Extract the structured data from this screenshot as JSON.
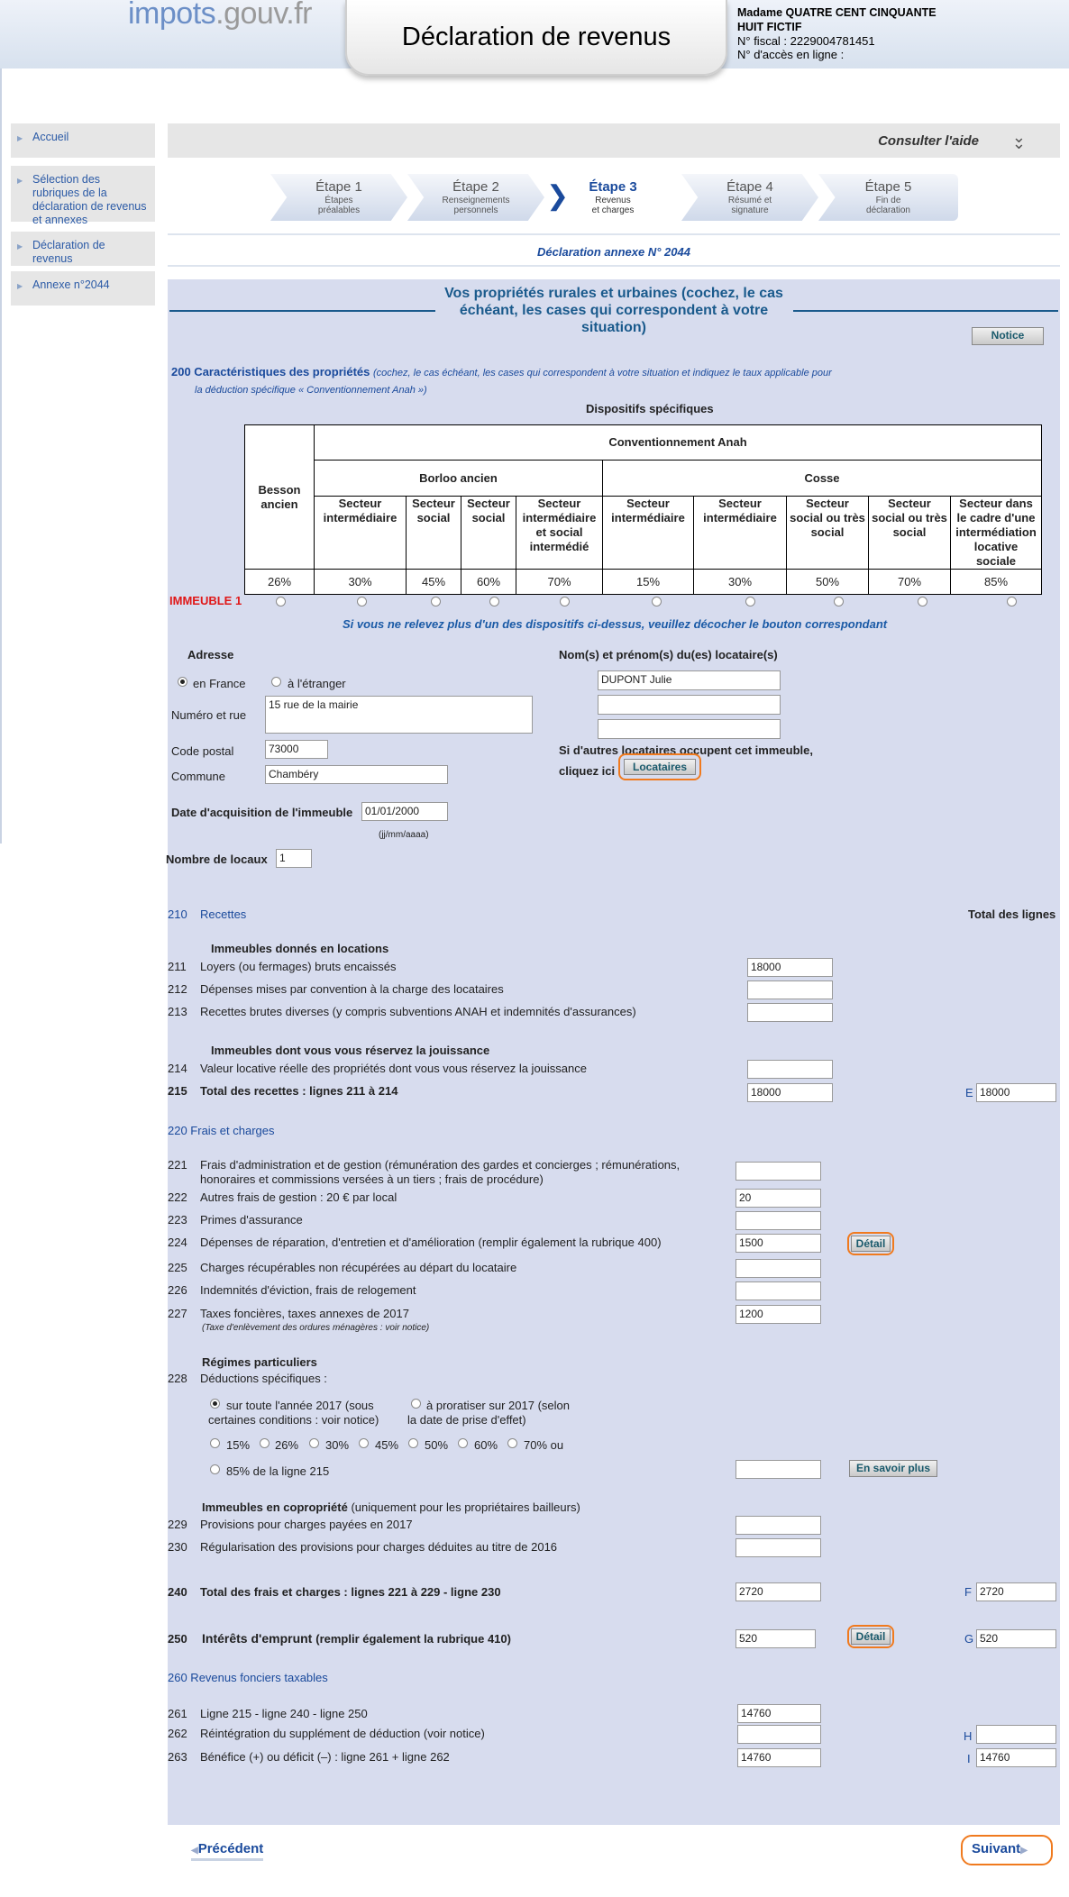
{
  "header": {
    "logo_main": "impots",
    "logo_domain": ".gouv.fr",
    "title": "Déclaration de revenus",
    "user_name": "Madame QUATRE CENT CINQUANTE HUIT FICTIF",
    "fiscal_number": "N° fiscal : 2229004781451",
    "access_number": "N° d'accès en ligne :"
  },
  "sidebar": {
    "items": [
      {
        "label": "Accueil"
      },
      {
        "label": "Sélection des rubriques de la déclaration de revenus et annexes"
      },
      {
        "label": "Déclaration de revenus"
      },
      {
        "label": "Annexe n°2044"
      }
    ]
  },
  "help": {
    "label": "Consulter l'aide",
    "icon": "double-chevron-down-icon"
  },
  "steps": [
    {
      "title": "Étape 1",
      "sub1": "Étapes",
      "sub2": "préalables"
    },
    {
      "title": "Étape 2",
      "sub1": "Renseignements",
      "sub2": "personnels"
    },
    {
      "title": "Étape 3",
      "sub1": "Revenus",
      "sub2": "et charges"
    },
    {
      "title": "Étape 4",
      "sub1": "Résumé et",
      "sub2": "signature"
    },
    {
      "title": "Étape 5",
      "sub1": "Fin de",
      "sub2": "déclaration"
    }
  ],
  "annexe_title": "Déclaration annexe N° 2044",
  "section": {
    "title_l1": "Vos propriétés rurales et urbaines (cochez, le cas",
    "title_l2": "échéant, les cases qui correspondent à votre",
    "title_l3": "situation)",
    "notice_button": "Notice"
  },
  "caract": {
    "number_title": "200 Caractéristiques des propriétés",
    "hint_l1": "(cochez, le cas échéant, les cases qui correspondent à votre situation et indiquez le taux applicable pour",
    "hint_l2": "la déduction spécifique « Conventionnement Anah »)",
    "dispositifs": "Dispositifs spécifiques"
  },
  "grid": {
    "anah": "Conventionnement Anah",
    "besson": "Besson ancien",
    "borloo": "Borloo ancien",
    "cosse": "Cosse",
    "cols": [
      "Secteur intermédiaire",
      "Secteur social",
      "Secteur social",
      "Secteur intermédiaire et social intermédié",
      "Secteur intermédiaire",
      "Secteur intermédiaire",
      "Secteur social ou très social",
      "Secteur social ou très social",
      "Secteur dans le cadre d'une intermédiation locative sociale"
    ],
    "pcts": [
      "26%",
      "30%",
      "45%",
      "60%",
      "70%",
      "15%",
      "30%",
      "50%",
      "70%",
      "85%"
    ]
  },
  "immeuble_label": "IMMEUBLE 1",
  "dispositif_note": "Si vous ne relevez plus d'un des dispositifs ci-dessus, veuillez décocher le bouton correspondant",
  "address": {
    "title": "Adresse",
    "opt_france": "en France",
    "opt_etranger": "à l'étranger",
    "street_label": "Numéro et rue",
    "street_value": "15 rue de la mairie",
    "postal_label": "Code postal",
    "postal_value": "73000",
    "commune_label": "Commune",
    "commune_value": "Chambéry",
    "acq_label": "Date d'acquisition de l'immeuble",
    "acq_value": "01/01/2000",
    "acq_format": "(jj/mm/aaaa)",
    "locaux_label": "Nombre de locaux",
    "locaux_value": "1"
  },
  "tenants": {
    "title": "Nom(s) et prénom(s) du(es) locataire(s)",
    "values": [
      "DUPONT Julie",
      "",
      ""
    ],
    "other_l1": "Si d'autres locataires occupent cet immeuble,",
    "other_l2": "cliquez ici",
    "button": "Locataires"
  },
  "recettes": {
    "num": "210",
    "title": "Recettes",
    "total_header": "Total des lignes",
    "sub1": "Immeubles donnés en locations",
    "sub2": "Immeubles dont vous vous réservez la jouissance",
    "rows": [
      {
        "num": "211",
        "label": "Loyers (ou fermages) bruts encaissés",
        "value": "18000"
      },
      {
        "num": "212",
        "label": "Dépenses mises par convention à la charge des locataires",
        "value": ""
      },
      {
        "num": "213",
        "label": "Recettes brutes diverses (y compris subventions ANAH et indemnités d'assurances)",
        "value": ""
      },
      {
        "num": "214",
        "label": "Valeur locative réelle des propriétés dont vous vous réservez la jouissance",
        "value": ""
      }
    ],
    "total": {
      "num": "215",
      "label": "Total des recettes : lignes 211 à 214",
      "value": "18000",
      "letter": "E",
      "letter_value": "18000"
    }
  },
  "frais": {
    "title": "220 Frais et charges",
    "rows": [
      {
        "num": "221",
        "label": "Frais d'administration et de gestion (rémunération des gardes et concierges ; rémunérations,",
        "label2": "honoraires et commissions versées à un tiers ; frais de procédure)",
        "value": ""
      },
      {
        "num": "222",
        "label": "Autres frais de gestion : 20 € par local",
        "value": "20"
      },
      {
        "num": "223",
        "label": "Primes d'assurance",
        "value": ""
      },
      {
        "num": "224",
        "label": "Dépenses de réparation, d'entretien et d'amélioration (remplir également la rubrique 400)",
        "value": "1500"
      },
      {
        "num": "225",
        "label": "Charges récupérables non récupérées au départ du locataire",
        "value": ""
      },
      {
        "num": "226",
        "label": "Indemnités d'éviction, frais de relogement",
        "value": ""
      },
      {
        "num": "227",
        "label": "Taxes foncières, taxes annexes de 2017",
        "label2": "(Taxe d'enlèvement des ordures ménagères : voir notice)",
        "value": "1200"
      }
    ],
    "detail_button": "Détail",
    "regimes": "Régimes particuliers",
    "ded_num": "228",
    "ded_label": "Déductions spécifiques :",
    "opt_all_l1": "sur toute l'année 2017 (sous",
    "opt_all_l2": "certaines conditions : voir notice)",
    "opt_prorata_l1": "à proratiser sur 2017 (selon",
    "opt_prorata_l2": "la date de prise d'effet)",
    "rates": [
      "15%",
      "26%",
      "30%",
      "45%",
      "50%",
      "60%",
      "70% ou"
    ],
    "rate_85": "85% de la ligne 215",
    "en_savoir_plus": "En savoir plus",
    "copro_title": "Immeubles en copropriété",
    "copro_hint": "(uniquement pour les propriétaires bailleurs)",
    "copro_rows": [
      {
        "num": "229",
        "label": "Provisions pour charges payées en 2017",
        "value": ""
      },
      {
        "num": "230",
        "label": "Régularisation des provisions pour charges déduites au titre de 2016",
        "value": ""
      }
    ],
    "total": {
      "num": "240",
      "label": "Total des frais et charges : lignes 221 à 229 - ligne 230",
      "value": "2720",
      "letter": "F",
      "letter_value": "2720"
    },
    "interets": {
      "num": "250",
      "label": "Intérêts d'emprunt",
      "hint": "(remplir également la rubrique 410)",
      "value": "520",
      "letter": "G",
      "letter_value": "520"
    }
  },
  "revenus": {
    "title": "260 Revenus fonciers taxables",
    "rows": [
      {
        "num": "261",
        "label": "Ligne 215 - ligne 240 - ligne 250",
        "value": "14760",
        "letter": "",
        "letter_value": ""
      },
      {
        "num": "262",
        "label": "Réintégration du supplément de déduction (voir notice)",
        "value": "",
        "letter": "H",
        "letter_value": ""
      },
      {
        "num": "263",
        "label": "Bénéfice (+) ou déficit (–) : ligne 261 + ligne 262",
        "value": "14760",
        "letter": "I",
        "letter_value": "14760"
      }
    ]
  },
  "nav": {
    "prev": "Précédent",
    "next": "Suivant"
  }
}
